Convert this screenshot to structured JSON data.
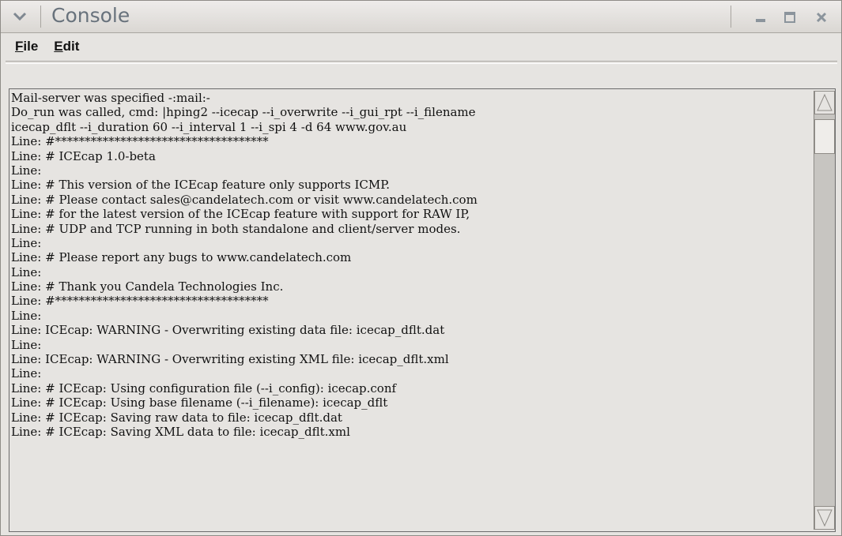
{
  "window": {
    "title": "Console",
    "icons": {
      "menu": "chevron-down-icon",
      "minimize": "minimize-icon",
      "maximize": "maximize-icon",
      "close": "close-icon"
    }
  },
  "menubar": {
    "file": {
      "mnemonic": "F",
      "rest": "ile"
    },
    "edit": {
      "mnemonic": "E",
      "rest": "dit"
    }
  },
  "console": {
    "lines": [
      "Mail-server was specified -:mail:-",
      "Do_run was called, cmd: |hping2 --icecap --i_overwrite --i_gui_rpt --i_filename",
      "icecap_dflt --i_duration 60 --i_interval 1 --i_spi 4 -d 64 www.gov.au",
      "Line: #************************************",
      "Line: # ICEcap 1.0-beta",
      "Line:",
      "Line: # This version of the ICEcap feature only supports ICMP.",
      "Line: # Please contact sales@candelatech.com or visit www.candelatech.com",
      "Line: # for the latest version of the ICEcap feature with support for RAW IP,",
      "Line: # UDP and TCP running in both standalone and client/server modes.",
      "Line:",
      "Line: # Please report any bugs to www.candelatech.com",
      "Line:",
      "Line: # Thank you Candela Technologies Inc.",
      "Line: #************************************",
      "Line:",
      "Line: ICEcap: WARNING - Overwriting existing data file: icecap_dflt.dat",
      "Line:",
      "Line: ICEcap: WARNING - Overwriting existing XML file: icecap_dflt.xml",
      "Line:",
      "Line: # ICEcap: Using configuration file (--i_config): icecap.conf",
      "Line: # ICEcap: Using base filename (--i_filename): icecap_dflt",
      "Line: # ICEcap: Saving raw data to file: icecap_dflt.dat",
      "Line: # ICEcap: Saving XML data to file: icecap_dflt.xml"
    ]
  },
  "colors": {
    "window_bg": "#e6e4e1",
    "title_text": "#68727c",
    "console_text": "#111111"
  }
}
